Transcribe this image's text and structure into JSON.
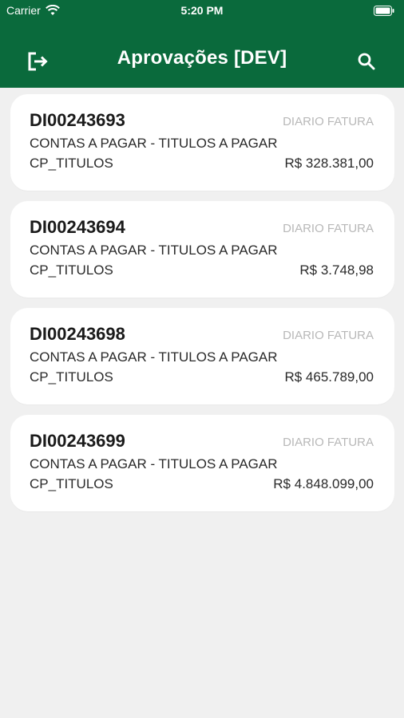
{
  "status_bar": {
    "carrier": "Carrier",
    "time": "5:20 PM",
    "wifi_icon": "wifi-icon",
    "battery_icon": "battery-icon"
  },
  "nav": {
    "title": "Aprovações [DEV]",
    "left_icon": "logout-icon",
    "right_icon": "search-icon"
  },
  "colors": {
    "header": "#0a6a3c",
    "background": "#f0f0f0",
    "card": "#ffffff",
    "muted": "#b8b8b8"
  },
  "items": [
    {
      "id": "DI00243693",
      "type": "DIARIO FATURA",
      "description": "CONTAS A PAGAR - TITULOS A PAGAR",
      "code": "CP_TITULOS",
      "amount": "R$ 328.381,00"
    },
    {
      "id": "DI00243694",
      "type": "DIARIO FATURA",
      "description": "CONTAS A PAGAR - TITULOS A PAGAR",
      "code": "CP_TITULOS",
      "amount": "R$ 3.748,98"
    },
    {
      "id": "DI00243698",
      "type": "DIARIO FATURA",
      "description": "CONTAS A PAGAR - TITULOS A PAGAR",
      "code": "CP_TITULOS",
      "amount": "R$ 465.789,00"
    },
    {
      "id": "DI00243699",
      "type": "DIARIO FATURA",
      "description": "CONTAS A PAGAR - TITULOS A PAGAR",
      "code": "CP_TITULOS",
      "amount": "R$ 4.848.099,00"
    }
  ]
}
